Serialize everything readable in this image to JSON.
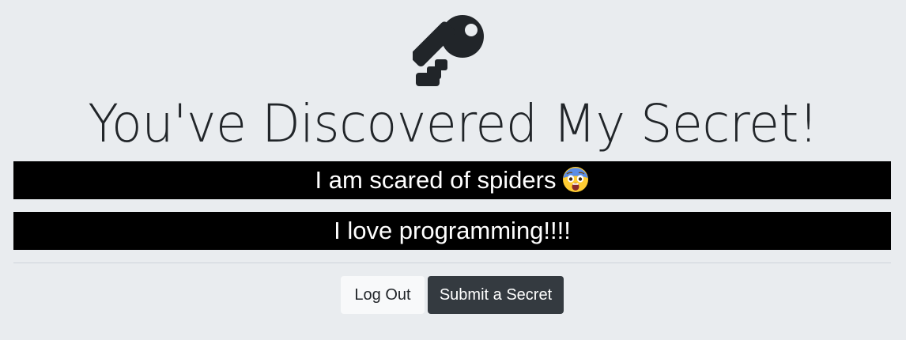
{
  "page": {
    "title": "You've Discovered My Secret!",
    "icon": "key-icon"
  },
  "secrets": [
    {
      "text": "I am scared of spiders",
      "emoji": "fearful-face-emoji"
    },
    {
      "text": "I love programming!!!!"
    }
  ],
  "actions": {
    "logout_label": "Log Out",
    "submit_label": "Submit a Secret"
  },
  "colors": {
    "background": "#e9ecef",
    "secret_background": "#000000",
    "secret_text": "#ffffff",
    "dark_button": "#343a40",
    "light_button": "#f8f9fa"
  }
}
